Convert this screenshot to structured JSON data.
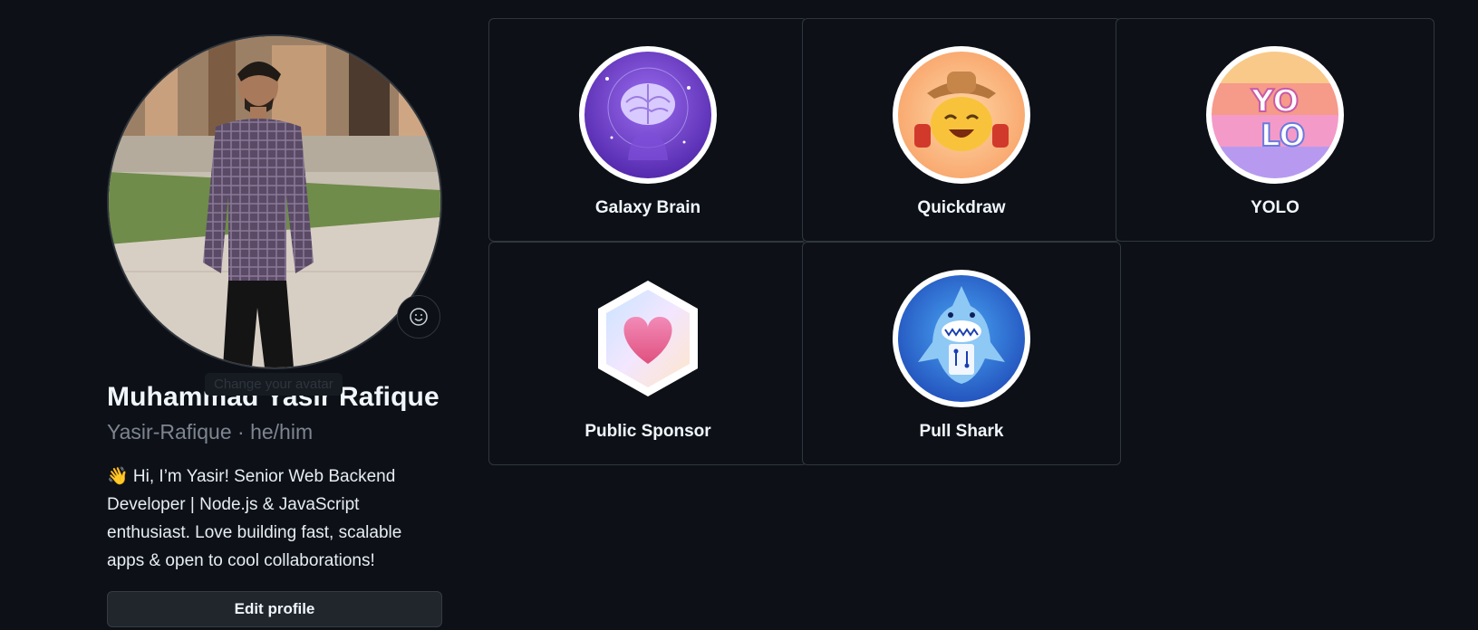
{
  "profile": {
    "name": "Muhammad Yasir Rafique",
    "login_line": "Yasir-Rafique · he/him",
    "bio": "👋 Hi, I’m Yasir! Senior Web Backend Developer | Node.js & JavaScript enthusiast. Love building fast, scalable apps & open to cool collaborations!",
    "avatar_tooltip": "Change your avatar",
    "edit_button": "Edit profile",
    "status_icon": "smiley-icon"
  },
  "achievements": [
    {
      "title": "Galaxy Brain",
      "icon": "galaxy-brain-icon"
    },
    {
      "title": "Quickdraw",
      "icon": "quickdraw-icon"
    },
    {
      "title": "YOLO",
      "icon": "yolo-icon"
    },
    {
      "title": "Public Sponsor",
      "icon": "public-sponsor-icon"
    },
    {
      "title": "Pull Shark",
      "icon": "pull-shark-icon"
    }
  ],
  "colors": {
    "background": "#0d1117",
    "border": "#30363d",
    "text": "#e6edf3",
    "muted": "#7d8590",
    "button_bg": "#21262d"
  }
}
